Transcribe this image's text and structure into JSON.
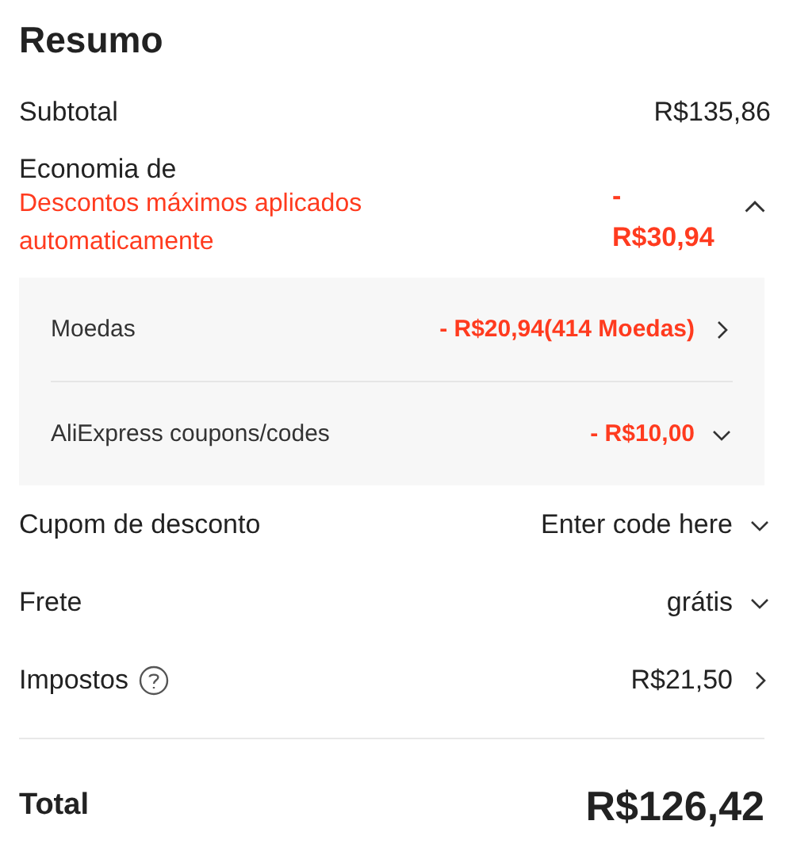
{
  "title": "Resumo",
  "subtotal": {
    "label": "Subtotal",
    "value": "R$135,86"
  },
  "savings": {
    "label": "Economia de",
    "note": "Descontos máximos aplicados automaticamente",
    "value": "- R$30,94",
    "expanded": true,
    "items": [
      {
        "label": "Moedas",
        "value": "- R$20,94(414 Moedas)",
        "kind": "link"
      },
      {
        "label": "AliExpress coupons/codes",
        "value": "- R$10,00",
        "kind": "dropdown"
      }
    ]
  },
  "rows": [
    {
      "label": "Cupom de desconto",
      "value": "Enter code here",
      "kind": "dropdown",
      "help": false
    },
    {
      "label": "Frete",
      "value": "grátis",
      "kind": "dropdown",
      "help": false
    },
    {
      "label": "Impostos",
      "value": "R$21,50",
      "kind": "link",
      "help": true
    }
  ],
  "total": {
    "label": "Total",
    "value": "R$126,42"
  }
}
